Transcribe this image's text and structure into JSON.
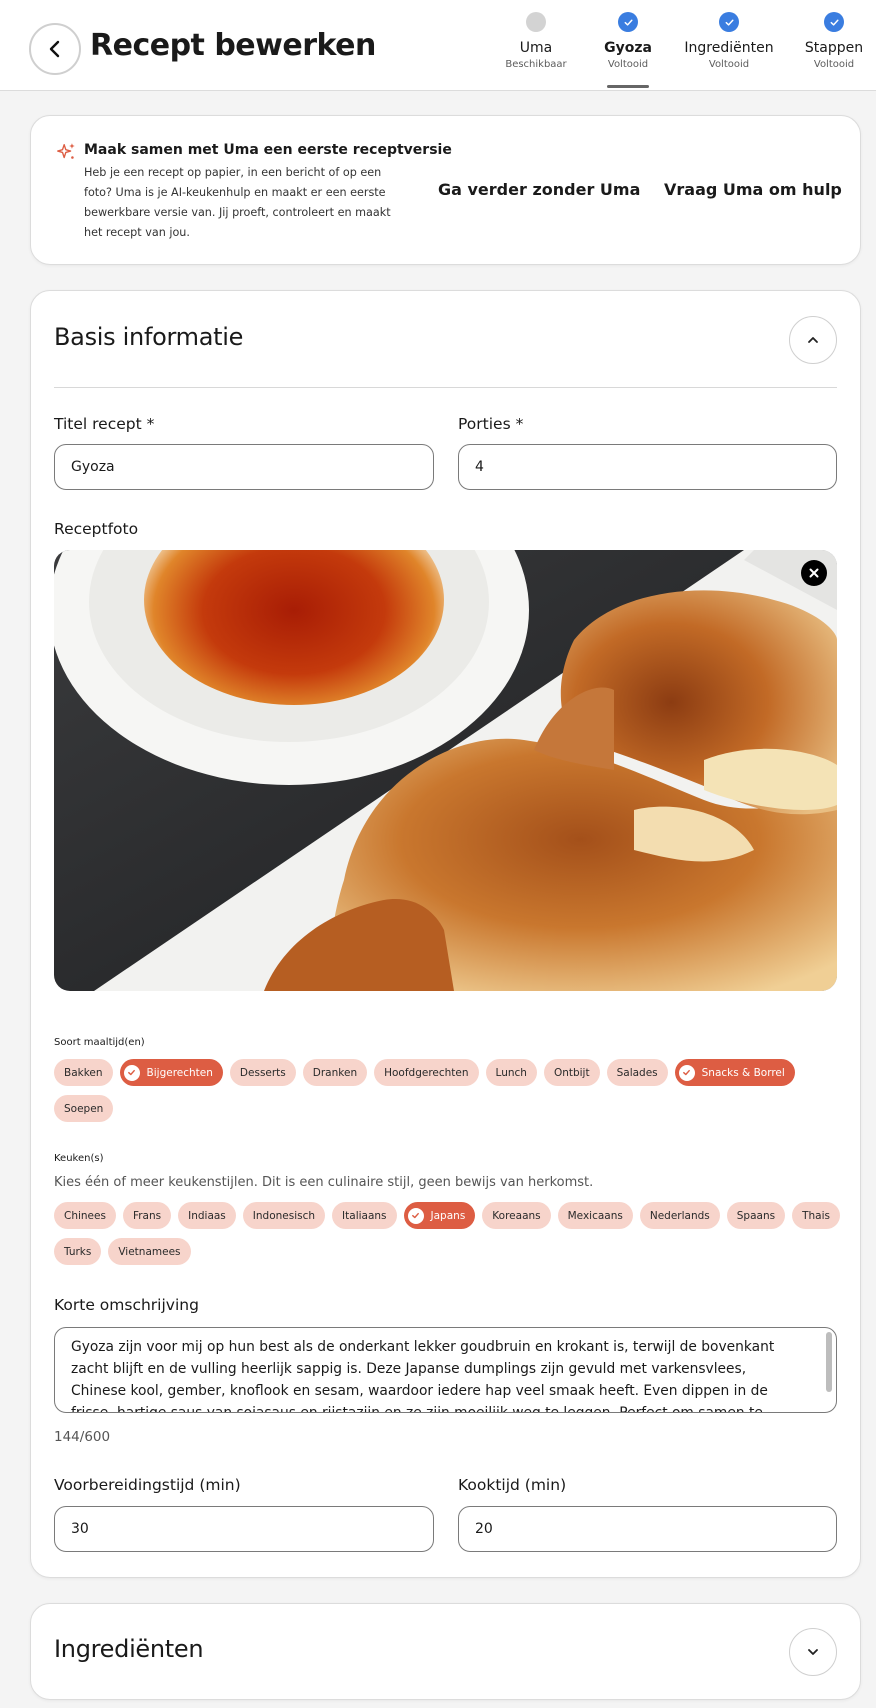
{
  "header": {
    "title": "Recept bewerken",
    "steps": [
      {
        "label": "Uma",
        "sub": "Beschikbaar",
        "state": "idle"
      },
      {
        "label": "Gyoza",
        "sub": "Voltooid",
        "state": "done",
        "active": true
      },
      {
        "label": "Ingrediënten",
        "sub": "Voltooid",
        "state": "done"
      },
      {
        "label": "Stappen",
        "sub": "Voltooid",
        "state": "done"
      }
    ]
  },
  "uma": {
    "title": "Maak samen met Uma een eerste receptversie",
    "description": "Heb je een recept op papier, in een bericht of op een foto? Uma is je AI-keukenhulp en maakt er een eerste bewerkbare versie van. Jij proeft, controleert en maakt het recept van jou.",
    "continue_label": "Ga verder zonder Uma",
    "help_label": "Vraag Uma om hulp"
  },
  "basis": {
    "title": "Basis informatie",
    "title_label": "Titel recept *",
    "title_value": "Gyoza",
    "portions_label": "Porties *",
    "portions_value": "4",
    "photo_label": "Receptfoto",
    "meal_label": "Soort maaltijd(en)",
    "meal_types": [
      {
        "label": "Bakken",
        "selected": false
      },
      {
        "label": "Bijgerechten",
        "selected": true
      },
      {
        "label": "Desserts",
        "selected": false
      },
      {
        "label": "Dranken",
        "selected": false
      },
      {
        "label": "Hoofdgerechten",
        "selected": false
      },
      {
        "label": "Lunch",
        "selected": false
      },
      {
        "label": "Ontbijt",
        "selected": false
      },
      {
        "label": "Salades",
        "selected": false
      },
      {
        "label": "Snacks & Borrel",
        "selected": true
      },
      {
        "label": "Soepen",
        "selected": false
      }
    ],
    "cuisine_label": "Keuken(s)",
    "cuisine_hint": "Kies één of meer keukenstijlen. Dit is een culinaire stijl, geen bewijs van herkomst.",
    "cuisines": [
      {
        "label": "Chinees",
        "selected": false
      },
      {
        "label": "Frans",
        "selected": false
      },
      {
        "label": "Indiaas",
        "selected": false
      },
      {
        "label": "Indonesisch",
        "selected": false
      },
      {
        "label": "Italiaans",
        "selected": false
      },
      {
        "label": "Japans",
        "selected": true
      },
      {
        "label": "Koreaans",
        "selected": false
      },
      {
        "label": "Mexicaans",
        "selected": false
      },
      {
        "label": "Nederlands",
        "selected": false
      },
      {
        "label": "Spaans",
        "selected": false
      },
      {
        "label": "Thais",
        "selected": false
      },
      {
        "label": "Turks",
        "selected": false
      },
      {
        "label": "Vietnamees",
        "selected": false
      }
    ],
    "description_label": "Korte omschrijving",
    "description_value": "Gyoza zijn voor mij op hun best als de onderkant lekker goudbruin en krokant is, terwijl de bovenkant zacht blijft en de vulling heerlijk sappig is. Deze Japanse dumplings zijn gevuld met varkensvlees, Chinese kool, gember, knoflook en sesam, waardoor iedere hap veel smaak heeft. Even dippen in de frisse, hartige saus van sojasaus en rijstazijn en ze zijn moeilijk weg te leggen. Perfect om samen te delen, al houd ik er zelf graag een paar extra achter.",
    "char_count": "144/600",
    "prep_label": "Voorbereidingstijd (min)",
    "prep_value": "30",
    "cook_label": "Kooktijd (min)",
    "cook_value": "20"
  },
  "ingredients": {
    "title": "Ingrediënten"
  },
  "colors": {
    "accent": "#dd5d43",
    "chip_bg": "#f7d4cb",
    "step_done": "#3a7de0",
    "step_idle": "#d3d3d3"
  },
  "icons": {
    "back": "chevron-left-icon",
    "sparkle": "sparkle-icon",
    "collapse": "chevron-up-icon",
    "expand": "chevron-down-icon",
    "remove_photo": "close-icon",
    "check": "check-icon"
  }
}
